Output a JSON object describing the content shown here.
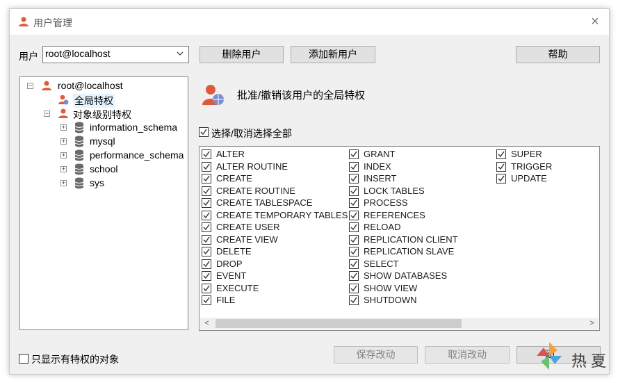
{
  "window": {
    "title": "用户管理",
    "close_symbol": "×"
  },
  "user": {
    "label": "用户",
    "selected": "root@localhost"
  },
  "toolbar": {
    "delete_user": "删除用户",
    "add_user": "添加新用户",
    "help": "帮助"
  },
  "tree": {
    "root": "root@localhost",
    "global": "全局特权",
    "object_level": "对象级别特权",
    "schemas": [
      "information_schema",
      "mysql",
      "performance_schema",
      "school",
      "sys"
    ]
  },
  "privileges": {
    "heading": "批准/撤销该用户的全局特权",
    "select_all_label": "选择/取消选择全部",
    "select_all_checked": true,
    "columns": [
      [
        "ALTER",
        "ALTER ROUTINE",
        "CREATE",
        "CREATE ROUTINE",
        "CREATE TABLESPACE",
        "CREATE TEMPORARY TABLES",
        "CREATE USER",
        "CREATE VIEW",
        "DELETE",
        "DROP",
        "EVENT",
        "EXECUTE",
        "FILE"
      ],
      [
        "GRANT",
        "INDEX",
        "INSERT",
        "LOCK TABLES",
        "PROCESS",
        "REFERENCES",
        "RELOAD",
        "REPLICATION CLIENT",
        "REPLICATION SLAVE",
        "SELECT",
        "SHOW DATABASES",
        "SHOW VIEW",
        "SHUTDOWN"
      ],
      [
        "SUPER",
        "TRIGGER",
        "UPDATE"
      ]
    ]
  },
  "footer": {
    "only_priv_label": "只显示有特权的对象",
    "only_priv_checked": false,
    "save": "保存改动",
    "cancel": "取消改动",
    "close_fragment": "闭"
  },
  "watermark": {
    "text": "热夏"
  },
  "colors": {
    "accent_user": "#e05a3a",
    "db_gray": "#6a6a6a",
    "check": "#3a3a3a"
  }
}
